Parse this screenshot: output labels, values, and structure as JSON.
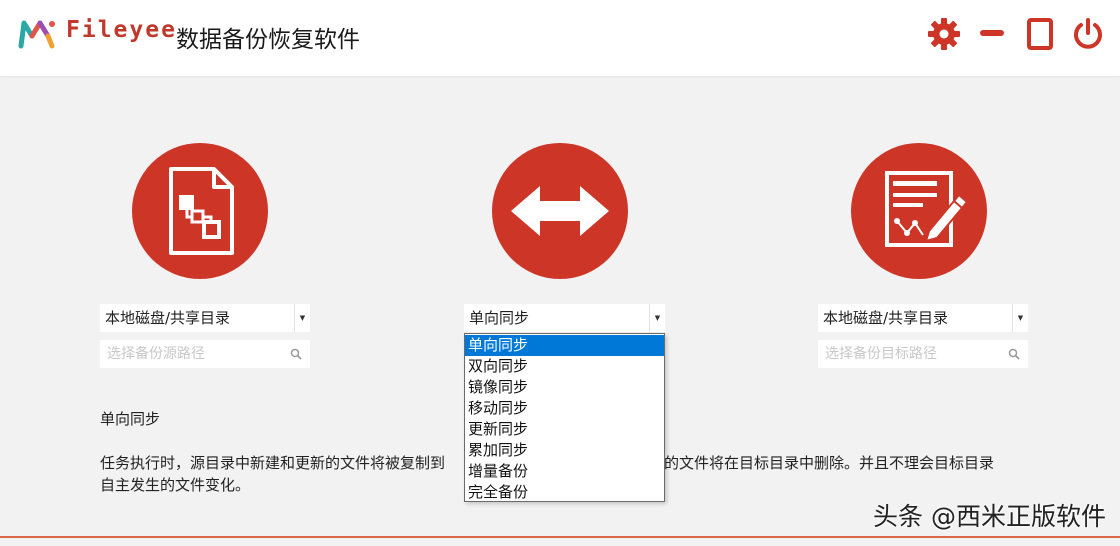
{
  "header": {
    "brand": "Fileyee",
    "title": "数据备份恢复软件",
    "buttons": [
      "gear-icon",
      "minimize-icon",
      "maximize-icon",
      "power-icon"
    ]
  },
  "colors": {
    "accent": "#cd3527",
    "selected": "#0078d7",
    "background": "#f2f2f2"
  },
  "source": {
    "icon": "document-flowchart-icon",
    "type_value": "本地磁盘/共享目录",
    "path_placeholder": "选择备份源路径"
  },
  "mode": {
    "icon": "double-arrow-icon",
    "selected_value": "单向同步",
    "options": [
      "单向同步",
      "双向同步",
      "镜像同步",
      "移动同步",
      "更新同步",
      "累加同步",
      "增量备份",
      "完全备份"
    ]
  },
  "target": {
    "icon": "document-edit-icon",
    "type_value": "本地磁盘/共享目录",
    "path_placeholder": "选择备份目标路径"
  },
  "description": {
    "title": "单向同步",
    "line1_left": "任务执行时，源目录中新建和更新的文件将被复制到",
    "line1_right": "的文件将在目标目录中删除。并且不理会目标目录",
    "line2": "自主发生的文件变化。"
  },
  "watermark": "头条 @西米正版软件"
}
